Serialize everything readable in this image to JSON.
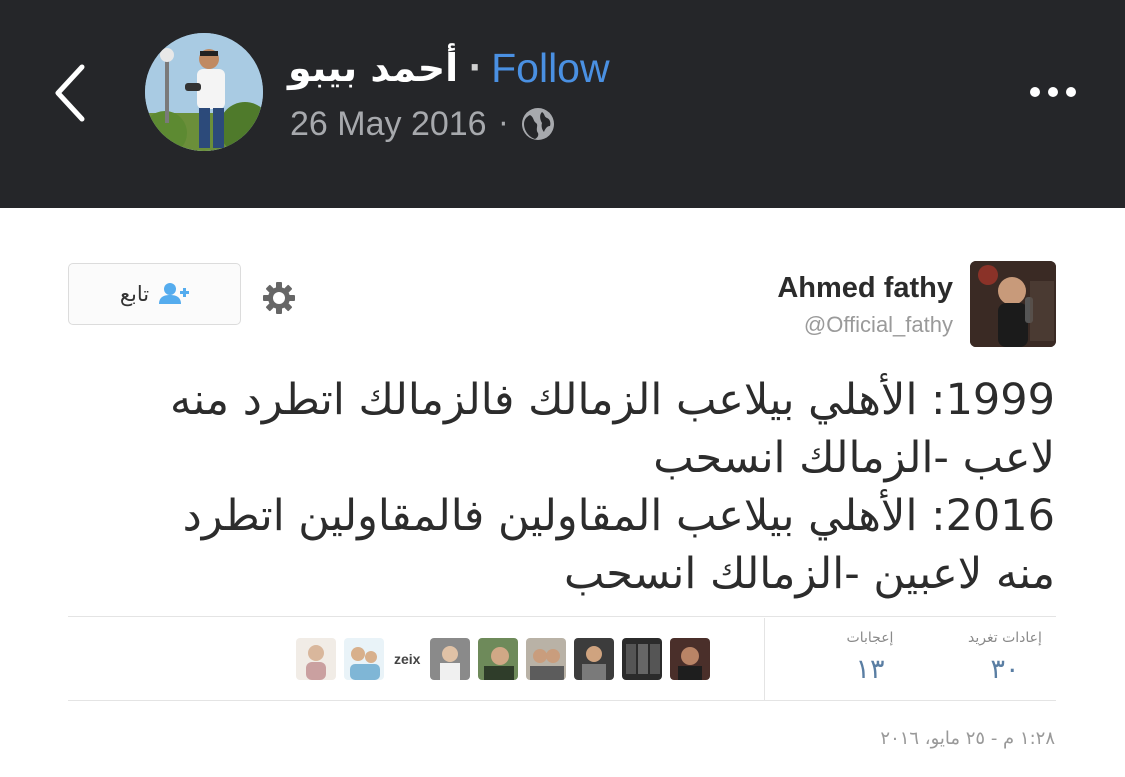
{
  "header": {
    "poster_name": "أحمد بيبو",
    "separator": "·",
    "follow_label": "Follow",
    "date": "26 May 2016",
    "meta_separator": "·",
    "privacy_icon": "globe-icon",
    "back_icon": "chevron-left-icon",
    "more_icon": "more-dots-icon"
  },
  "tweet": {
    "follow_button_label": "تابع",
    "follow_icon": "add-user-icon",
    "settings_icon": "gear-icon",
    "author_name": "Ahmed fathy",
    "author_handle": "@Official_fathy",
    "text_lines": [
      "1999: الأهلي بيلاعب الزمالك فالزمالك اتطرد منه",
      "لاعب -الزمالك انسحب",
      "2016: الأهلي بيلاعب المقاولين فالمقاولين اتطرد",
      "منه لاعبين -الزمالك انسحب"
    ],
    "retweets_label": "إعادات تغريد",
    "retweets_value": "٣٠",
    "likes_label": "إعجابات",
    "likes_value": "١٣",
    "liker_text": "zeix",
    "timestamp": "١:٢٨ م - ٢٥ مايو، ٢٠١٦"
  },
  "colors": {
    "header_bg": "#252629",
    "follow_blue": "#4a90e2",
    "stat_blue": "#5a7ea3"
  }
}
